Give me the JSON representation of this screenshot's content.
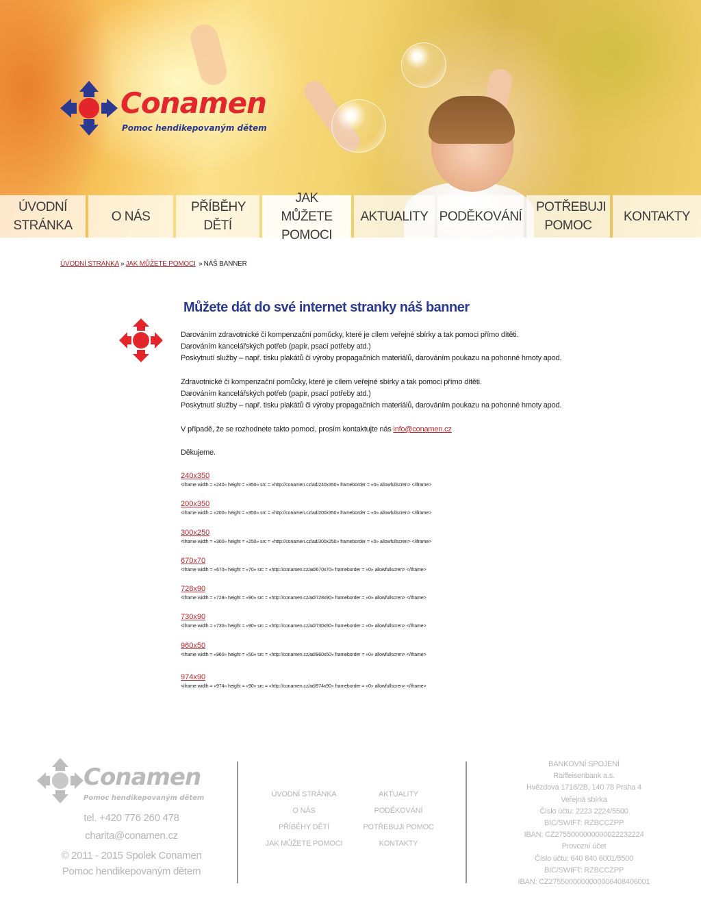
{
  "brand": {
    "name": "Conamen",
    "tagline": "Pomoc hendikepovaným dětem",
    "colors": {
      "red": "#e3262b",
      "blue": "#2b3990",
      "link": "#c0272d",
      "footer_gray": "#b5b5b5"
    }
  },
  "nav": {
    "items": [
      {
        "label": "ÚVODNÍ STRÁNKA"
      },
      {
        "label": "O NÁS"
      },
      {
        "label": "PŘÍBĚHY DĚTÍ"
      },
      {
        "label": "JAK MŮŽETE POMOCI",
        "active": true
      },
      {
        "label": "AKTUALITY"
      },
      {
        "label": "PODĚKOVÁNÍ"
      },
      {
        "label": "POTŘEBUJI POMOC"
      },
      {
        "label": "KONTAKTY"
      }
    ]
  },
  "breadcrumb": {
    "home": "ÚVODNÍ STRÁNKA",
    "parent": "JAK MŮŽETE POMOCI",
    "current": "NÁŠ BANNER",
    "separator": "»"
  },
  "main": {
    "title": "Můžete dát do své internet stranky náš banner",
    "paragraph1": [
      "Darováním zdravotnické či kompenzační pomůcky, které je cílem veřejné sbírky a tak pomoci přímo dítěti.",
      "Darováním kancelářských potřeb (papír, psací potřeby atd.)",
      "Poskytnutí služby – např. tisku plakátů či výroby propagačních materiálů, darováním poukazu na pohonné hmoty apod."
    ],
    "paragraph2": [
      "Zdravotnické či kompenzační pomůcky, které je cílem veřejné sbírky a tak pomoci přímo dítěti.",
      "Darováním kancelářských potřeb (papír, psací potřeby atd.)",
      "Poskytnutí služby – např. tisku plakátů či výroby propagačních materiálů, darováním poukazu na pohonné hmoty apod."
    ],
    "contact_text": "V případě, že se rozhodnete takto pomoci, prosím kontaktujte nás ",
    "contact_email": "info@conamen.cz",
    "thanks": "Děkujeme.",
    "banners": [
      {
        "size": "240x350",
        "code": "<iframe width = «240» height = «350» src = «http://conamen.cz/ad/240x350» frameborder = «0» allowfullscren> </iframe>"
      },
      {
        "size": "200x350",
        "code": "<iframe width = «200» height = «350» src = «http://conamen.cz/ad/200x350» frameborder = «0» allowfullscren> </iframe>"
      },
      {
        "size": "300x250",
        "code": "<iframe width = «300» height = «250» src = «http://conamen.cz/ad/300x250» frameborder = «0» allowfullscren> </iframe>"
      },
      {
        "size": "670x70",
        "code": "<iframe width = «670» height = «70» src = «http://conamen.cz/ad/670x70» frameborder = «0» allowfullscren> </iframe>"
      },
      {
        "size": "728x90",
        "code": "<iframe width = «728» height = «90» src = «http://conamen.cz/ad/728x90» frameborder = «0» allowfullscren> </iframe>"
      },
      {
        "size": "730x90",
        "code": "<iframe width = «730» height = «90» src = «http://conamen.cz/ad/730x90» frameborder = «0» allowfullscren> </iframe>"
      },
      {
        "size": "960x50",
        "code": "<iframe width = «960» height = «50» src = «http://conamen.cz/ad/960x50» frameborder = «0» allowfullscren> </iframe>"
      },
      {
        "size": "974x90",
        "code": "<iframe width = «974» height = «90» src = «http://conamen.cz/ad/974x90» frameborder = «0» allowfullscren> </iframe>"
      }
    ]
  },
  "footer": {
    "phone": "tel. +420 776 260 478",
    "email": "charita@conamen.cz",
    "copyright": "© 2011 - 2015 Spolek Conamen",
    "tagline": "Pomoc hendikepovaným dětem",
    "nav_col1": [
      "ÚVODNÍ STRÁNKA",
      "O NÁS",
      "PŘÍBĚHY DĚTÍ",
      "JAK MŮŽETE POMOCI"
    ],
    "nav_col2": [
      "AKTUALITY",
      "PODĚKOVÁNÍ",
      "POTŘEBUJI POMOC",
      "KONTAKTY"
    ],
    "bank": [
      "BANKOVNÍ SPOJENÍ",
      "Raiffeisenbank a.s.",
      "Hvězdova 1716/2B, 140 78 Praha 4",
      "Veřejná sbírka",
      "Číslo účtu: 2223 2224/5500",
      "BIC/SWIFT: RZBCCZPP",
      "IBAN: CZ2755000000000022232224",
      "Provozní účet",
      "Číslo účtu: 640 840 6001/5500",
      "BIC/SWIFT: RZBCCZPP",
      "IBAN: CZ2755000000000006408406001"
    ]
  }
}
